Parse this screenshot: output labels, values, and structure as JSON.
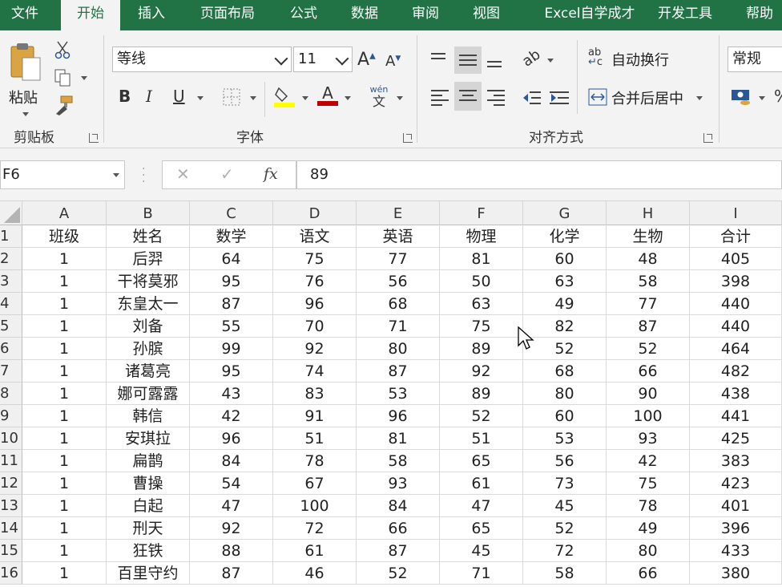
{
  "ribbon_tabs": [
    {
      "label": "文件",
      "active": false
    },
    {
      "label": "开始",
      "active": true
    },
    {
      "label": "插入",
      "active": false
    },
    {
      "label": "页面布局",
      "active": false
    },
    {
      "label": "公式",
      "active": false
    },
    {
      "label": "数据",
      "active": false
    },
    {
      "label": "审阅",
      "active": false
    },
    {
      "label": "视图",
      "active": false
    },
    {
      "label": "Excel自学成才",
      "active": false
    },
    {
      "label": "开发工具",
      "active": false
    },
    {
      "label": "帮助",
      "active": false
    }
  ],
  "clipboard": {
    "paste_label": "粘贴",
    "group_label": "剪贴板",
    "icons": [
      "paste-icon",
      "cut-icon",
      "copy-icon",
      "format-painter-icon"
    ]
  },
  "font": {
    "group_label": "字体",
    "font_name": "等线",
    "font_size": "11",
    "grow_label": "A",
    "shrink_label": "A",
    "bold_label": "B",
    "italic_label": "I",
    "underline_label": "U",
    "font_color_label": "A",
    "phonetic_top": "wén",
    "phonetic_bottom": "文",
    "fill_color": "#ffff00",
    "font_color": "#c00000"
  },
  "alignment": {
    "group_label": "对齐方式",
    "wrap_text_label": "自动换行",
    "merge_center_label": "合并后居中",
    "wrap_icon_text": "ab"
  },
  "number": {
    "format": "常规",
    "percent_label": "%"
  },
  "formula_bar": {
    "name_box": "F6",
    "fx_label": "fx",
    "cancel_symbol": "✕",
    "enter_symbol": "✓",
    "formula_value": "89"
  },
  "sheet": {
    "column_letters": [
      "A",
      "B",
      "C",
      "D",
      "E",
      "F",
      "G",
      "H",
      "I"
    ],
    "row_numbers": [
      "1",
      "2",
      "3",
      "4",
      "5",
      "6",
      "7",
      "8",
      "9",
      "10",
      "11",
      "12",
      "13",
      "14",
      "15",
      "16"
    ],
    "rows": [
      [
        "班级",
        "姓名",
        "数学",
        "语文",
        "英语",
        "物理",
        "化学",
        "生物",
        "合计"
      ],
      [
        "1",
        "后羿",
        "64",
        "75",
        "77",
        "81",
        "60",
        "48",
        "405"
      ],
      [
        "1",
        "干将莫邪",
        "95",
        "76",
        "56",
        "50",
        "63",
        "58",
        "398"
      ],
      [
        "1",
        "东皇太一",
        "87",
        "96",
        "68",
        "63",
        "49",
        "77",
        "440"
      ],
      [
        "1",
        "刘备",
        "55",
        "70",
        "71",
        "75",
        "82",
        "87",
        "440"
      ],
      [
        "1",
        "孙膑",
        "99",
        "92",
        "80",
        "89",
        "52",
        "52",
        "464"
      ],
      [
        "1",
        "诸葛亮",
        "95",
        "74",
        "87",
        "92",
        "68",
        "66",
        "482"
      ],
      [
        "1",
        "娜可露露",
        "43",
        "83",
        "53",
        "89",
        "80",
        "90",
        "438"
      ],
      [
        "1",
        "韩信",
        "42",
        "91",
        "96",
        "52",
        "60",
        "100",
        "441"
      ],
      [
        "1",
        "安琪拉",
        "96",
        "51",
        "81",
        "51",
        "53",
        "93",
        "425"
      ],
      [
        "1",
        "扁鹊",
        "84",
        "78",
        "58",
        "65",
        "56",
        "42",
        "383"
      ],
      [
        "1",
        "曹操",
        "54",
        "67",
        "93",
        "61",
        "73",
        "75",
        "423"
      ],
      [
        "1",
        "白起",
        "47",
        "100",
        "84",
        "47",
        "45",
        "78",
        "401"
      ],
      [
        "1",
        "刑天",
        "92",
        "72",
        "66",
        "65",
        "52",
        "49",
        "396"
      ],
      [
        "1",
        "狂铁",
        "88",
        "61",
        "87",
        "45",
        "72",
        "80",
        "433"
      ],
      [
        "1",
        "百里守约",
        "87",
        "46",
        "52",
        "71",
        "58",
        "66",
        "380"
      ]
    ]
  },
  "colors": {
    "accent": "#217346",
    "ribbon_bg": "#f3f3f3"
  }
}
